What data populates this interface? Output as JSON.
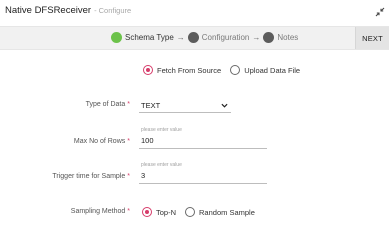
{
  "window": {
    "title": "Native DFSReceiver",
    "subtitle": "- Configure"
  },
  "stepper": {
    "steps": [
      {
        "label": "Schema Type",
        "state": "active"
      },
      {
        "label": "Configuration",
        "state": "inactive"
      },
      {
        "label": "Notes",
        "state": "inactive"
      }
    ],
    "arrow": "→",
    "next_label": "NEXT"
  },
  "source": {
    "options": [
      {
        "label": "Fetch From Source",
        "selected": true
      },
      {
        "label": "Upload Data File",
        "selected": false
      }
    ]
  },
  "form": {
    "type_of_data": {
      "label": "Type of Data",
      "value": "TEXT"
    },
    "max_rows": {
      "label": "Max No of Rows",
      "hint": "please enter value",
      "value": "100"
    },
    "trigger_time": {
      "label": "Trigger time for Sample",
      "hint": "please enter value",
      "value": "3"
    },
    "sampling_method": {
      "label": "Sampling Method",
      "options": [
        {
          "label": "Top-N",
          "selected": true
        },
        {
          "label": "Random Sample",
          "selected": false
        }
      ]
    },
    "required_mark": "*"
  },
  "colors": {
    "accent": "#d63c6a",
    "step_active": "#6cc24a",
    "step_inactive": "#5c5c5c"
  },
  "icons": {
    "expand": "expand-icon",
    "chevron": "chevron-down-icon"
  }
}
